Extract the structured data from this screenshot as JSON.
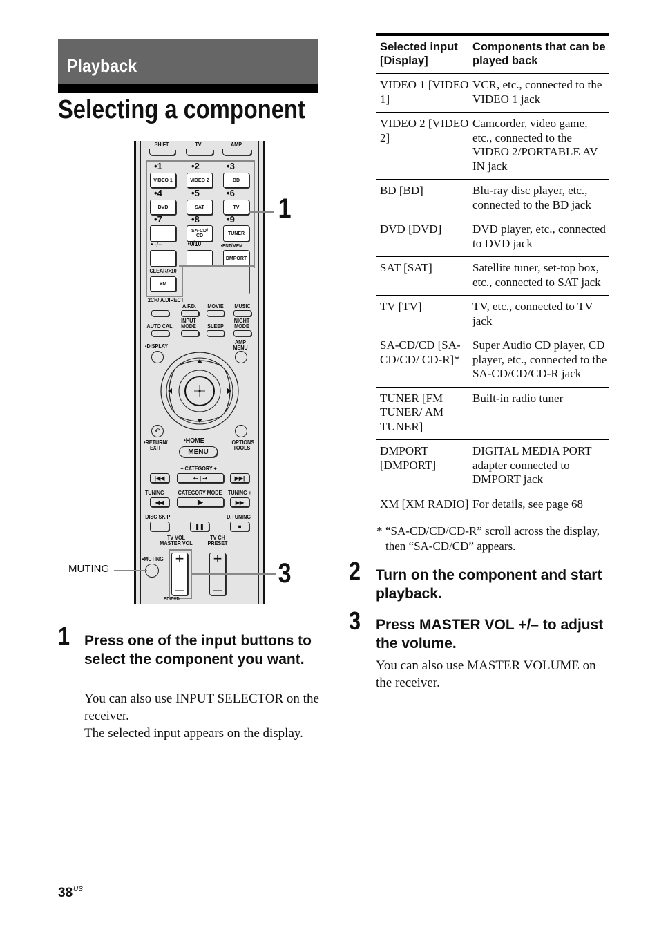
{
  "header": {
    "section": "Playback",
    "title": "Selecting a component"
  },
  "remote": {
    "top_buttons": [
      "SHIFT",
      "TV",
      "AMP"
    ],
    "numbers": [
      "1",
      "2",
      "3",
      "4",
      "5",
      "6",
      "7",
      "8",
      "9",
      "-/--",
      "0/10",
      "ENT/MEM"
    ],
    "input_buttons": [
      "VIDEO 1",
      "VIDEO 2",
      "BD",
      "DVD",
      "SAT",
      "TV",
      "",
      "SA-CD/ CD",
      "TUNER",
      "",
      "",
      "DMPORT"
    ],
    "clear_label": "CLEAR/>10",
    "xm_button": "XM",
    "mode_labels": [
      "2CH/ A.DIRECT",
      "A.F.D.",
      "MOVIE",
      "MUSIC",
      "AUTO CAL",
      "INPUT MODE",
      "SLEEP",
      "NIGHT MODE"
    ],
    "display_label": "DISPLAY",
    "amp_menu_label": "AMP MENU",
    "return_label": "RETURN/ EXIT",
    "home_label": "HOME",
    "menu_label": "MENU",
    "options_label": "OPTIONS TOOLS",
    "category_label": "– CATEGORY +",
    "tuning_minus": "TUNING –",
    "category_mode": "CATEGORY MODE",
    "tuning_plus": "TUNING +",
    "disc_skip": "DISC SKIP",
    "d_tuning": "D.TUNING",
    "tv_vol": "TV VOL MASTER VOL",
    "tv_ch": "TV CH PRESET",
    "muting_small": "MUTING",
    "bd_dvd": "BD/DVD",
    "plus": "+",
    "minus": "–"
  },
  "callouts": {
    "muting": "MUTING",
    "one": "1",
    "three": "3"
  },
  "steps": [
    {
      "num": "1",
      "heading": "Press one of the input buttons to select the component you want.",
      "body": [
        "You can also use INPUT SELECTOR on the receiver.",
        "The selected input appears on the display."
      ]
    },
    {
      "num": "2",
      "heading": "Turn on the component and start playback.",
      "body": []
    },
    {
      "num": "3",
      "heading": "Press MASTER VOL +/– to adjust the volume.",
      "body": [
        "You can also use MASTER VOLUME on the receiver."
      ]
    }
  ],
  "table": {
    "headers": [
      "Selected input [Display]",
      "Components that can be played back"
    ],
    "rows": [
      [
        "VIDEO 1 [VIDEO 1]",
        "VCR, etc., connected to the VIDEO 1 jack"
      ],
      [
        "VIDEO 2 [VIDEO 2]",
        "Camcorder, video game, etc., connected to the VIDEO 2/PORTABLE AV IN jack"
      ],
      [
        "BD [BD]",
        "Blu-ray disc player, etc., connected to the BD jack"
      ],
      [
        "DVD [DVD]",
        "DVD player, etc., connected to DVD jack"
      ],
      [
        "SAT [SAT]",
        "Satellite tuner, set-top box, etc., connected to SAT jack"
      ],
      [
        "TV [TV]",
        "TV, etc., connected to TV jack"
      ],
      [
        "SA-CD/CD [SA-CD/CD/ CD-R]*",
        "Super Audio CD player, CD player, etc., connected to the SA-CD/CD/CD-R jack"
      ],
      [
        "TUNER [FM TUNER/ AM TUNER]",
        "Built-in radio tuner"
      ],
      [
        "DMPORT [DMPORT]",
        "DIGITAL MEDIA PORT adapter connected to DMPORT jack"
      ],
      [
        "XM [XM RADIO]",
        "For details, see page 68"
      ]
    ],
    "footnote_mark": "*",
    "footnote": "“SA-CD/CD/CD-R” scroll across the display, then “SA-CD/CD” appears."
  },
  "footer": {
    "page_number": "38",
    "page_suffix": "US"
  }
}
